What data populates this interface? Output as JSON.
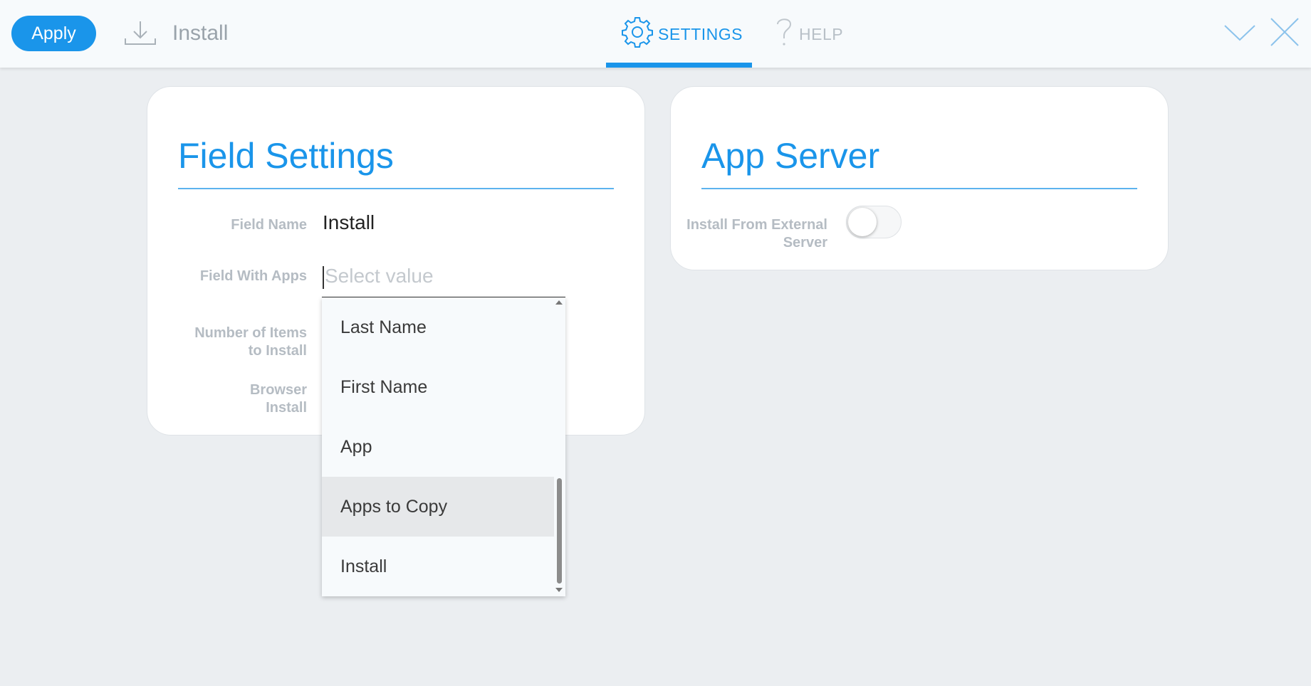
{
  "toolbar": {
    "apply_label": "Apply",
    "install_label": "Install",
    "install_icon": "download-icon",
    "minimize_icon": "chevron-down-icon",
    "close_icon": "close-icon"
  },
  "tabs": [
    {
      "label": "SETTINGS",
      "icon": "gear-icon",
      "active": true
    },
    {
      "label": "HELP",
      "icon": "question-icon",
      "active": false
    }
  ],
  "field_settings": {
    "title": "Field Settings",
    "field_name_label": "Field Name",
    "field_name_value": "Install",
    "field_with_apps_label": "Field With Apps",
    "field_with_apps_placeholder": "Select value",
    "number_items_label": "Number of Items to Install",
    "browser_install_label": "Browser Install"
  },
  "app_server": {
    "title": "App Server",
    "install_external_label": "Install From External Server",
    "install_external_on": false
  },
  "dropdown": {
    "options": [
      "Last Name",
      "First Name",
      "App",
      "Apps to Copy",
      "Install"
    ],
    "highlighted": "Apps to Copy"
  },
  "colors": {
    "accent": "#1a95ea",
    "background": "#ebeef1",
    "label_gray": "#b5bcc3"
  }
}
